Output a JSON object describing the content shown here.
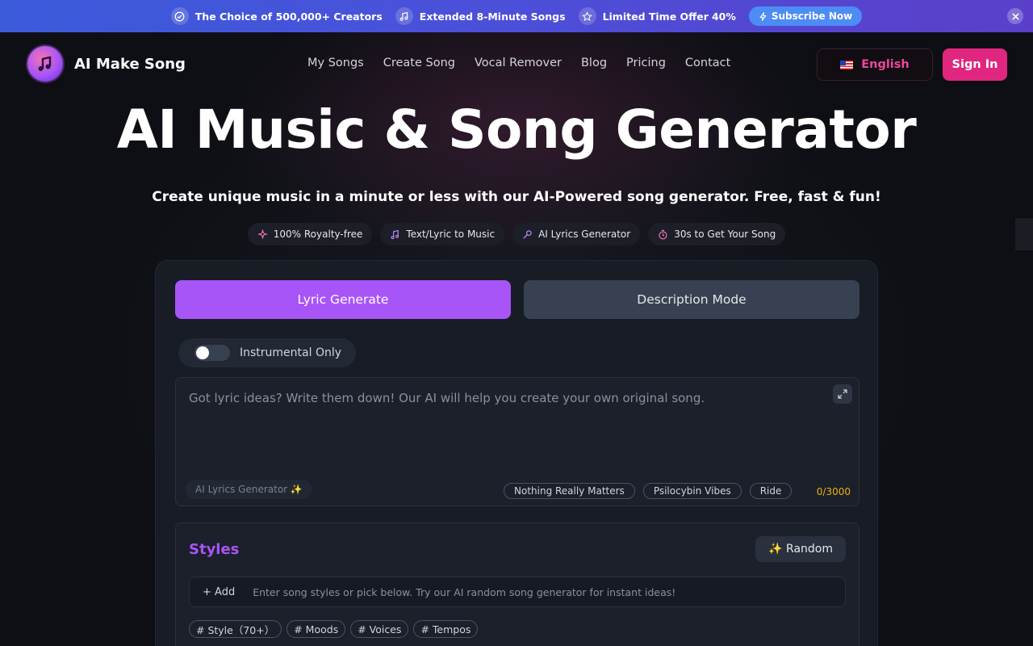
{
  "promo": {
    "items": [
      {
        "icon": "check-badge-icon",
        "text": "The Choice of 500,000+ Creators"
      },
      {
        "icon": "music-note-icon",
        "text": "Extended 8-Minute Songs"
      },
      {
        "icon": "star-icon",
        "text": "Limited Time Offer",
        "strong": "40%"
      }
    ],
    "subscribe_label": "Subscribe Now"
  },
  "header": {
    "brand": "AI Make Song",
    "nav": [
      "My Songs",
      "Create Song",
      "Vocal Remover",
      "Blog",
      "Pricing",
      "Contact"
    ],
    "language": "English",
    "signin_label": "Sign In"
  },
  "hero": {
    "title": "AI Music & Song Generator",
    "subtitle": "Create unique music in a minute or less with our AI-Powered song generator. Free, fast & fun!",
    "features": [
      {
        "icon": "sparkle-icon",
        "label": "100% Royalty-free"
      },
      {
        "icon": "music-note-icon",
        "label": "Text/Lyric to Music"
      },
      {
        "icon": "microphone-icon",
        "label": "AI Lyrics Generator"
      },
      {
        "icon": "timer-icon",
        "label": "30s to Get Your Song"
      }
    ]
  },
  "generator": {
    "tab_lyric": "Lyric Generate",
    "tab_description": "Description Mode",
    "instrumental_label": "Instrumental Only",
    "lyrics_placeholder": "Got lyric ideas? Write them down! Our AI will help you create your own original song.",
    "ai_lyrics_label": "AI Lyrics Generator ✨",
    "suggestions": [
      "Nothing Really Matters",
      "Psilocybin Vibes",
      "Ride"
    ],
    "char_count": "0/3000",
    "styles_title": "Styles",
    "random_label": "✨ Random",
    "add_label": "+ Add",
    "styles_placeholder": "Enter song styles or pick below. Try our AI random song generator for instant ideas!",
    "categories": [
      "# Style（70+）",
      "# Moods",
      "# Voices",
      "# Tempos"
    ]
  },
  "colors": {
    "accent": "#a855f7",
    "brand_pink": "#e0267f",
    "promo_blue": "#3b5bdb"
  }
}
